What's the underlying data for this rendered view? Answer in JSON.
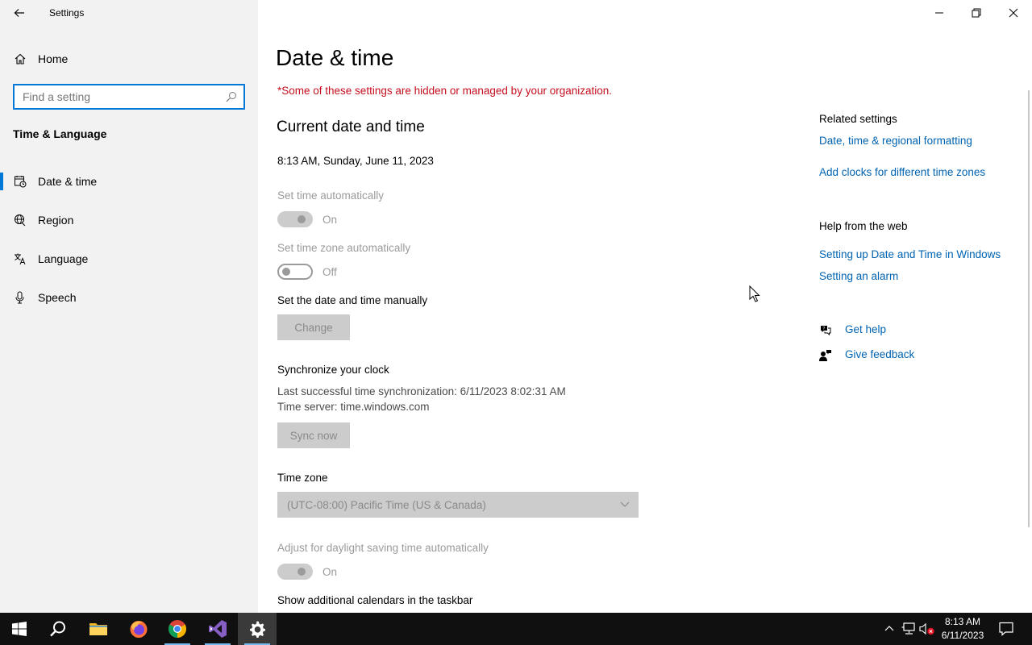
{
  "window": {
    "title": "Settings"
  },
  "sidebar": {
    "home_label": "Home",
    "search_placeholder": "Find a setting",
    "section_title": "Time & Language",
    "items": [
      {
        "label": "Date & time",
        "icon": "calendar-clock-icon",
        "active": true
      },
      {
        "label": "Region",
        "icon": "globe-icon",
        "active": false
      },
      {
        "label": "Language",
        "icon": "language-icon",
        "active": false
      },
      {
        "label": "Speech",
        "icon": "microphone-icon",
        "active": false
      }
    ]
  },
  "main": {
    "title": "Date & time",
    "org_notice": "*Some of these settings are hidden or managed by your organization.",
    "current_heading": "Current date and time",
    "current_value": "8:13 AM, Sunday, June 11, 2023",
    "set_time_auto": {
      "label": "Set time automatically",
      "state": "On"
    },
    "set_timezone_auto": {
      "label": "Set time zone automatically",
      "state": "Off"
    },
    "manual_label": "Set the date and time manually",
    "change_button": "Change",
    "sync_heading": "Synchronize your clock",
    "last_sync": "Last successful time synchronization: 6/11/2023 8:02:31 AM",
    "time_server": "Time server: time.windows.com",
    "sync_button": "Sync now",
    "timezone_label": "Time zone",
    "timezone_value": "(UTC-08:00) Pacific Time (US & Canada)",
    "dst": {
      "label": "Adjust for daylight saving time automatically",
      "state": "On"
    },
    "calendars_label": "Show additional calendars in the taskbar"
  },
  "related": {
    "heading": "Related settings",
    "links": [
      "Date, time & regional formatting",
      "Add clocks for different time zones"
    ],
    "help_heading": "Help from the web",
    "help_links": [
      "Setting up Date and Time in Windows",
      "Setting an alarm"
    ],
    "get_help": "Get help",
    "give_feedback": "Give feedback"
  },
  "taskbar": {
    "apps": [
      "start-button",
      "search",
      "file-explorer",
      "firefox",
      "chrome",
      "visual-studio",
      "settings"
    ],
    "time": "8:13 AM",
    "date": "6/11/2023"
  },
  "colors": {
    "accent": "#0078d7",
    "link": "#0063b1",
    "warning": "#c50f1f",
    "sidebar_bg": "#f2f2f2",
    "taskbar_bg": "#101010"
  }
}
